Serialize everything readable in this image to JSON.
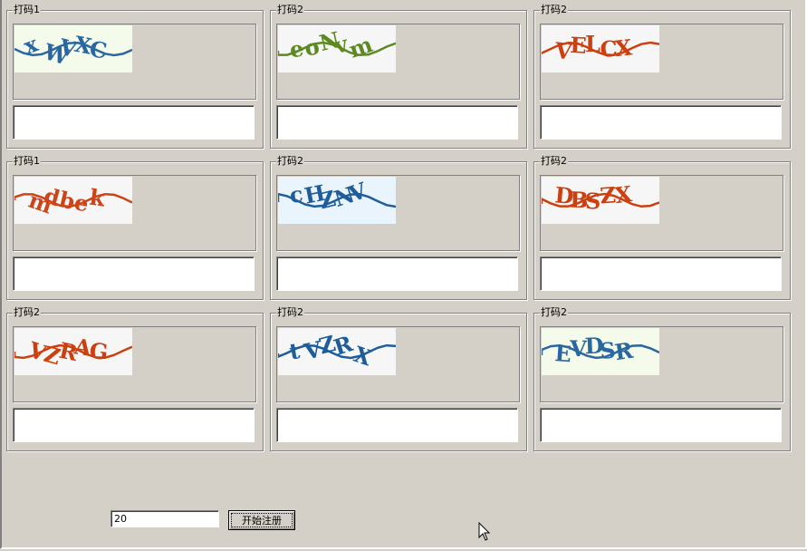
{
  "panels": [
    {
      "title": "打码1",
      "captcha": {
        "text": "xWVXC",
        "color": "#2a66a0",
        "bg": "#f4fbea"
      },
      "answer": ""
    },
    {
      "title": "打码2",
      "captcha": {
        "text": "eoNvm",
        "color": "#5c8a20",
        "bg": "#f6f6f6"
      },
      "answer": ""
    },
    {
      "title": "打码2",
      "captcha": {
        "text": "VELCX",
        "color": "#cc4010",
        "bg": "#f6f6f6"
      },
      "answer": ""
    },
    {
      "title": "打码1",
      "captcha": {
        "text": "mdbek",
        "color": "#cc4418",
        "bg": "#f6f6f6"
      },
      "answer": ""
    },
    {
      "title": "打码2",
      "captcha": {
        "text": "cHZNV",
        "color": "#1f5d9a",
        "bg": "#eaf4fc"
      },
      "answer": ""
    },
    {
      "title": "打码2",
      "captcha": {
        "text": "DBSZX",
        "color": "#cc4010",
        "bg": "#f6f6f6"
      },
      "answer": ""
    },
    {
      "title": "打码2",
      "captcha": {
        "text": "VZRAG",
        "color": "#cc4010",
        "bg": "#f6f6f6"
      },
      "answer": ""
    },
    {
      "title": "打码2",
      "captcha": {
        "text": "tVZRX",
        "color": "#1f5d9a",
        "bg": "#f6f6f6"
      },
      "answer": ""
    },
    {
      "title": "打码2",
      "captcha": {
        "text": "EVDSR",
        "color": "#2a66a0",
        "bg": "#f4fbea"
      },
      "answer": ""
    }
  ],
  "controls": {
    "count_value": "20",
    "start_button_label": "开始注册"
  }
}
